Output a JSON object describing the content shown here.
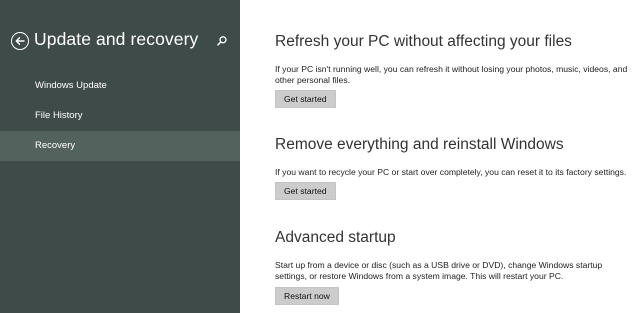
{
  "sidebar": {
    "title": "Update and recovery",
    "items": [
      {
        "label": "Windows Update"
      },
      {
        "label": "File History"
      },
      {
        "label": "Recovery"
      }
    ],
    "selected": "Recovery"
  },
  "sections": [
    {
      "title": "Refresh your PC without affecting your files",
      "description": "If your PC isn't running well, you can refresh it without losing your photos, music, videos, and other personal files.",
      "button": "Get started"
    },
    {
      "title": "Remove everything and reinstall Windows",
      "description": "If you want to recycle your PC or start over completely, you can reset it to its factory settings.",
      "button": "Get started"
    },
    {
      "title": "Advanced startup",
      "description": "Start up from a device or disc (such as a USB drive or DVD), change Windows startup settings, or restore Windows from a system image. This will restart your PC.",
      "button": "Restart now"
    }
  ],
  "colors": {
    "sidebar_bg": "#3f4b48",
    "sidebar_selected_bg": "#54625e",
    "button_bg": "#cccccc"
  },
  "icons": {
    "back": "back-arrow-circle-icon",
    "search": "search-icon"
  }
}
